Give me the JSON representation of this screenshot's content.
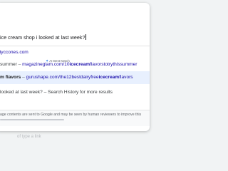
{
  "omnibox": {
    "query": "ice cream shop i looked at last week?",
    "results": [
      {
        "text": "ityccones.com"
      },
      {
        "badge_icon": "sparkle-icon",
        "badge": "AI Best Match"
      },
      {
        "prefix": "summer",
        "dash": " – ",
        "url_plain": "magazineglam.com/10",
        "url_bold": "icecream",
        "url_tail": "flavorstotrythissummer"
      },
      {
        "prefix_bold": "m flavors",
        "dash": " – ",
        "url_plain": "gurushape.com/the12bestdairyfree",
        "url_bold": "icecream",
        "url_tail": "flavors"
      },
      {
        "prefix": "looked at last week?",
        "suffix": " – Search History for more results"
      }
    ],
    "footer": "age contents are sent to Google and may be seen by human reviewers to improve this"
  },
  "background_text": "of type a link",
  "colors": {
    "url": "#1a0dab",
    "highlight": "#e8f0fe",
    "badge_icon": "#1a73e8"
  }
}
